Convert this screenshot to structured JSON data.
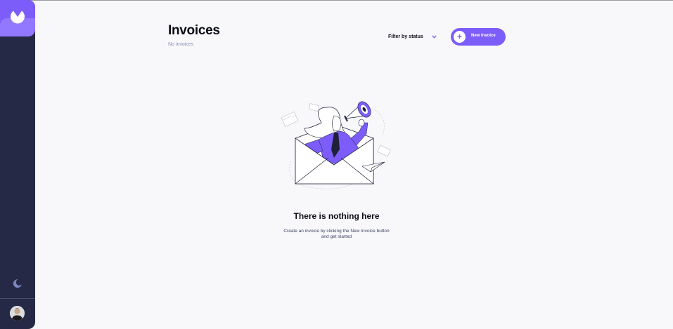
{
  "header": {
    "title": "Invoices",
    "subtitle": "No invoices",
    "filter_label": "Filter by status",
    "new_invoice_label": "New Invoice"
  },
  "empty_state": {
    "heading": "There is nothing here",
    "description": "Create an invoice by clicking the New Invoice button and get started"
  },
  "icons": {
    "logo": "logo-icon",
    "theme": "moon-icon",
    "filter": "chevron-down-icon",
    "new": "plus-icon",
    "avatar": "avatar"
  },
  "colors": {
    "accent": "#7c5dfa",
    "accent_light": "#9277ff",
    "sidebar": "#252945",
    "background": "#f8f8fb"
  }
}
